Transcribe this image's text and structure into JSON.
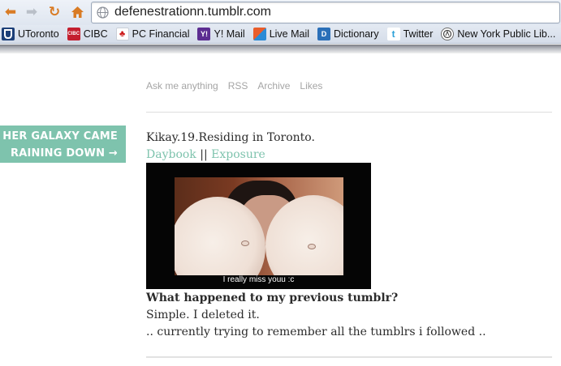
{
  "browser": {
    "url": "defenestrationn.tumblr.com",
    "bookmarks": [
      {
        "label": "UToronto",
        "icon": "utoronto-icon"
      },
      {
        "label": "CIBC",
        "icon": "cibc-icon"
      },
      {
        "label": "PC Financial",
        "icon": "pc-financial-icon"
      },
      {
        "label": "Y! Mail",
        "icon": "yahoo-mail-icon"
      },
      {
        "label": "Live Mail",
        "icon": "live-mail-icon"
      },
      {
        "label": "Dictionary",
        "icon": "dictionary-icon"
      },
      {
        "label": "Twitter",
        "icon": "twitter-icon"
      },
      {
        "label": "New York Public Lib...",
        "icon": "nypl-icon"
      }
    ],
    "bookmark_icon_text": {
      "cibc": "CIBC",
      "pc": "♣",
      "ymail": "Y!",
      "dict": "D",
      "tw": "t"
    }
  },
  "blog": {
    "nav": [
      "Ask me anything",
      "RSS",
      "Archive",
      "Likes"
    ],
    "tag_line1": "HER GALAXY CAME",
    "tag_line2": "RAINING DOWN →",
    "bio": "Kikay.19.Residing in Toronto.",
    "link_daybook": "Daybook",
    "link_separator": " || ",
    "link_exposure": "Exposure",
    "video_caption": "I really miss youu :c",
    "post_title": "What happened to my previous tumblr?",
    "post_line1": "Simple. I deleted it.",
    "post_line2": ".. currently trying to remember all the tumblrs i followed .."
  },
  "colors": {
    "accent": "#7ec3ad",
    "text": "#2b2b2b",
    "nav_text": "#a5a5a5"
  }
}
